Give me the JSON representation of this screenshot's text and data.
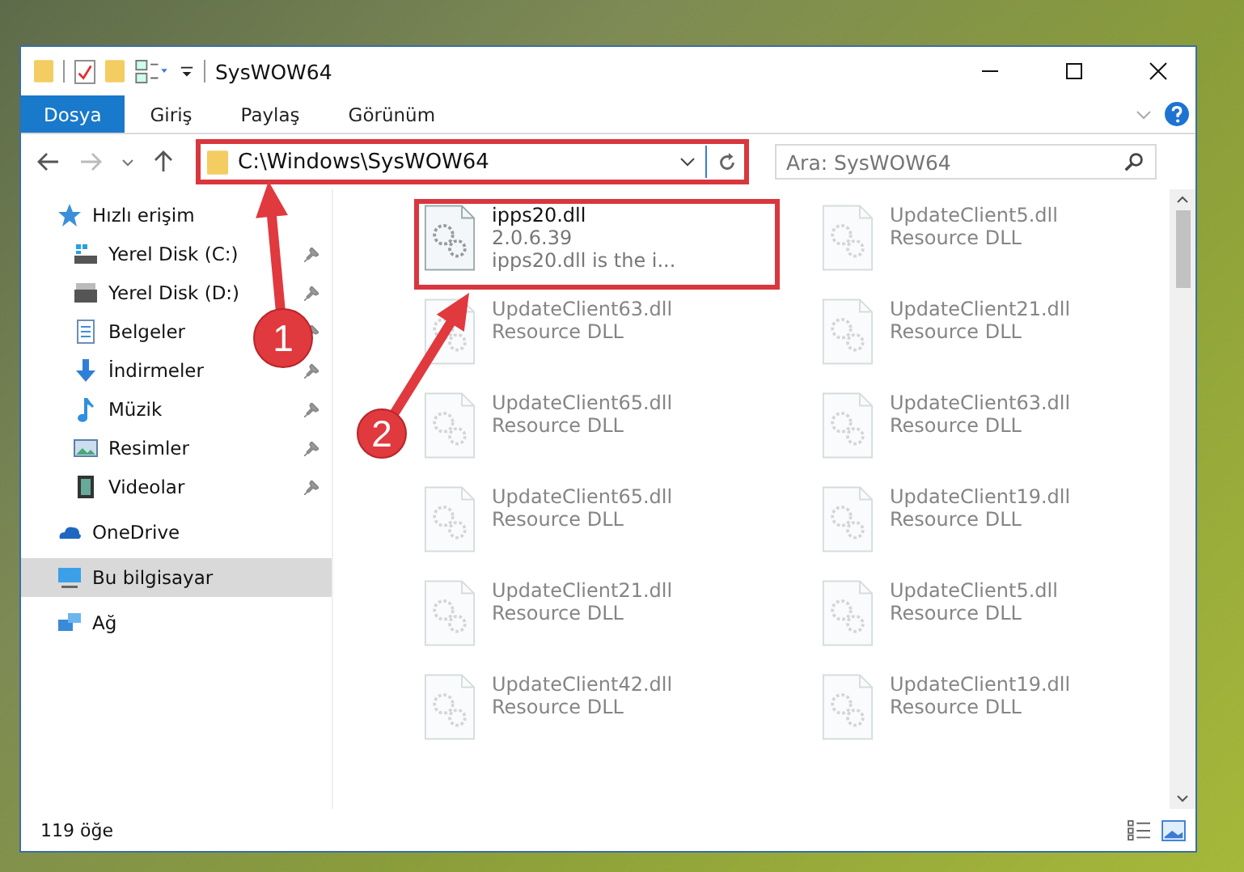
{
  "window": {
    "title": "SysWOW64"
  },
  "ribbon_tabs": [
    {
      "label": "Dosya",
      "selected": true
    },
    {
      "label": "Giriş",
      "selected": false
    },
    {
      "label": "Paylaş",
      "selected": false
    },
    {
      "label": "Görünüm",
      "selected": false
    }
  ],
  "address": {
    "path": "C:\\Windows\\SysWOW64",
    "highlighted": true
  },
  "search": {
    "placeholder": "Ara: SysWOW64"
  },
  "sidebar": {
    "items": [
      {
        "label": "Hızlı erişim",
        "kind": "star",
        "selected": false,
        "children": [
          {
            "label": "Yerel Disk (C:)",
            "kind": "drive-c",
            "pinned": true
          },
          {
            "label": "Yerel Disk (D:)",
            "kind": "drive",
            "pinned": true
          },
          {
            "label": "Belgeler",
            "kind": "document",
            "pinned": true
          },
          {
            "label": "İndirmeler",
            "kind": "download",
            "pinned": true
          },
          {
            "label": "Müzik",
            "kind": "music",
            "pinned": true
          },
          {
            "label": "Resimler",
            "kind": "picture",
            "pinned": true
          },
          {
            "label": "Videolar",
            "kind": "video",
            "pinned": true
          }
        ]
      },
      {
        "label": "OneDrive",
        "kind": "cloud",
        "selected": false
      },
      {
        "label": "Bu bilgisayar",
        "kind": "computer",
        "selected": true
      },
      {
        "label": "Ağ",
        "kind": "network",
        "selected": false
      }
    ]
  },
  "files": [
    {
      "name": "ipps20.dll",
      "details": [
        "2.0.6.39",
        "ipps20.dll is the i..."
      ],
      "highlighted": true,
      "faded": false
    },
    {
      "name": "UpdateClient5.dll",
      "details": [
        "Resource DLL"
      ],
      "highlighted": false,
      "faded": true
    },
    {
      "name": "UpdateClient63.dll",
      "details": [
        "Resource DLL"
      ],
      "highlighted": false,
      "faded": true
    },
    {
      "name": "UpdateClient21.dll",
      "details": [
        "Resource DLL"
      ],
      "highlighted": false,
      "faded": true
    },
    {
      "name": "UpdateClient65.dll",
      "details": [
        "Resource DLL"
      ],
      "highlighted": false,
      "faded": true
    },
    {
      "name": "UpdateClient63.dll",
      "details": [
        "Resource DLL"
      ],
      "highlighted": false,
      "faded": true
    },
    {
      "name": "UpdateClient65.dll",
      "details": [
        "Resource DLL"
      ],
      "highlighted": false,
      "faded": true
    },
    {
      "name": "UpdateClient19.dll",
      "details": [
        "Resource DLL"
      ],
      "highlighted": false,
      "faded": true
    },
    {
      "name": "UpdateClient21.dll",
      "details": [
        "Resource DLL"
      ],
      "highlighted": false,
      "faded": true
    },
    {
      "name": "UpdateClient5.dll",
      "details": [
        "Resource DLL"
      ],
      "highlighted": false,
      "faded": true
    },
    {
      "name": "UpdateClient42.dll",
      "details": [
        "Resource DLL"
      ],
      "highlighted": false,
      "faded": true
    },
    {
      "name": "UpdateClient19.dll",
      "details": [
        "Resource DLL"
      ],
      "highlighted": false,
      "faded": true
    }
  ],
  "callouts": [
    {
      "number": "1"
    },
    {
      "number": "2"
    }
  ],
  "status_bar": {
    "count": "119 öğe"
  }
}
